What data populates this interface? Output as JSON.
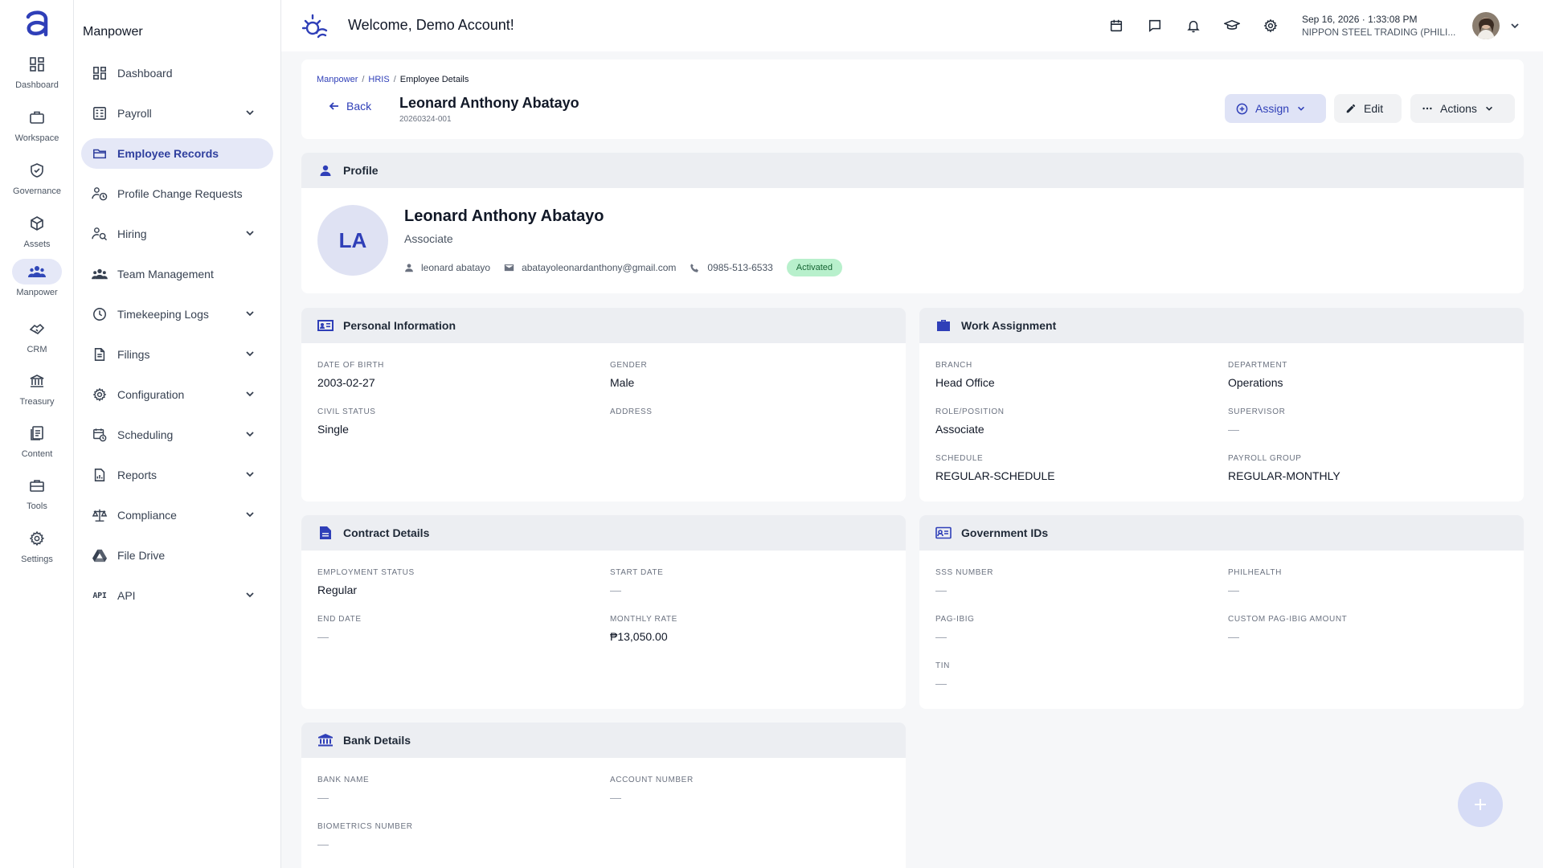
{
  "rail": {
    "items": [
      {
        "label": "Dashboard",
        "icon": "dashboard-icon"
      },
      {
        "label": "Workspace",
        "icon": "briefcase-icon"
      },
      {
        "label": "Governance",
        "icon": "shield-icon"
      },
      {
        "label": "Assets",
        "icon": "cube-icon"
      },
      {
        "label": "Manpower",
        "icon": "people-icon"
      },
      {
        "label": "CRM",
        "icon": "handshake-icon"
      },
      {
        "label": "Treasury",
        "icon": "bank-icon"
      },
      {
        "label": "Content",
        "icon": "document-icon"
      },
      {
        "label": "Tools",
        "icon": "toolbox-icon"
      },
      {
        "label": "Settings",
        "icon": "gear-icon"
      }
    ],
    "active": "Manpower"
  },
  "sidenav": {
    "title": "Manpower",
    "items": [
      {
        "label": "Dashboard"
      },
      {
        "label": "Payroll"
      },
      {
        "label": "Employee Records"
      },
      {
        "label": "Profile Change Requests"
      },
      {
        "label": "Hiring"
      },
      {
        "label": "Team Management"
      },
      {
        "label": "Timekeeping Logs"
      },
      {
        "label": "Filings"
      },
      {
        "label": "Configuration"
      },
      {
        "label": "Scheduling"
      },
      {
        "label": "Reports"
      },
      {
        "label": "Compliance"
      },
      {
        "label": "File Drive"
      },
      {
        "label": "API"
      }
    ],
    "api_icon_text": "API"
  },
  "header": {
    "welcome": "Welcome, Demo Account!",
    "date": "Sep 16, 2026 ·",
    "time": "1:33:08 PM",
    "company": "NIPPON STEEL TRADING (PHILI..."
  },
  "page": {
    "breadcrumb": [
      "Manpower",
      "HRIS",
      "Employee Details"
    ],
    "back_label": "Back",
    "employee_name": "Leonard Anthony Abatayo",
    "employee_id": "20260324-001",
    "assign_label": "Assign",
    "edit_label": "Edit",
    "actions_label": "Actions"
  },
  "profile": {
    "section_title": "Profile",
    "initials": "LA",
    "name": "Leonard Anthony Abatayo",
    "role": "Associate",
    "username": "leonard abatayo",
    "email": "abatayoleonardanthony@gmail.com",
    "phone": "0985-513-6533",
    "status": "Activated"
  },
  "personal": {
    "section_title": "Personal Information",
    "dob_label": "DATE OF BIRTH",
    "dob": "2003-02-27",
    "gender_label": "GENDER",
    "gender": "Male",
    "civil_label": "CIVIL STATUS",
    "civil": "Single",
    "address_label": "ADDRESS",
    "address": ""
  },
  "work": {
    "section_title": "Work Assignment",
    "branch_label": "BRANCH",
    "branch": "Head Office",
    "department_label": "DEPARTMENT",
    "department": "Operations",
    "role_label": "ROLE/POSITION",
    "role": "Associate",
    "supervisor_label": "SUPERVISOR",
    "supervisor": "—",
    "schedule_label": "SCHEDULE",
    "schedule": "REGULAR-SCHEDULE",
    "payroll_label": "PAYROLL GROUP",
    "payroll": "REGULAR-MONTHLY"
  },
  "contract": {
    "section_title": "Contract Details",
    "status_label": "EMPLOYMENT STATUS",
    "status": "Regular",
    "start_label": "START DATE",
    "start": "—",
    "end_label": "END DATE",
    "end": "—",
    "rate_label": "MONTHLY RATE",
    "rate": "₱13,050.00"
  },
  "gov": {
    "section_title": "Government IDs",
    "sss_label": "SSS NUMBER",
    "sss": "—",
    "philhealth_label": "PHILHEALTH",
    "philhealth": "—",
    "pagibig_label": "PAG-IBIG",
    "pagibig": "—",
    "custom_label": "CUSTOM PAG-IBIG AMOUNT",
    "custom": "—",
    "tin_label": "TIN",
    "tin": "—"
  },
  "bank": {
    "section_title": "Bank Details",
    "name_label": "BANK NAME",
    "name": "—",
    "account_label": "ACCOUNT NUMBER",
    "account": "—",
    "bio_label": "BIOMETRICS NUMBER",
    "bio": "—"
  },
  "colors": {
    "accent": "#2f3fb8",
    "active_bg": "#e5e8f7",
    "badge_bg": "#b8f0cc"
  }
}
